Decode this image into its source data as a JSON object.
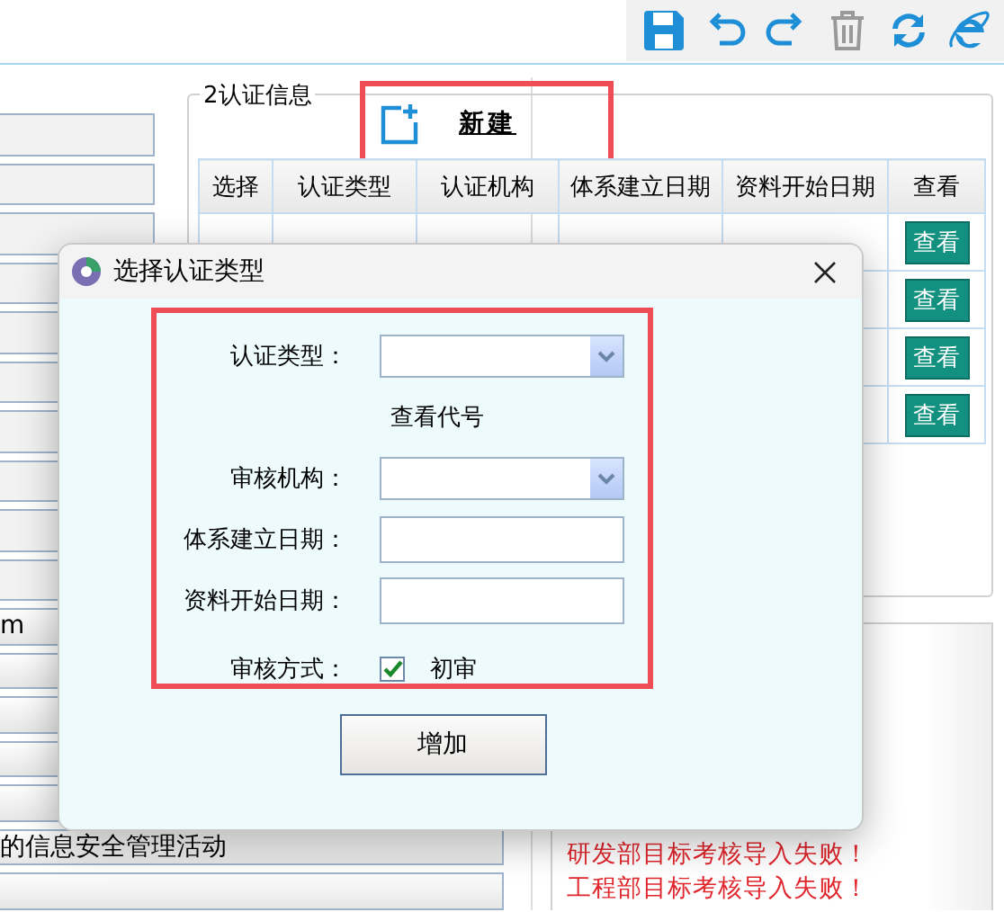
{
  "left_panel": {
    "rows": [
      "m",
      "的信息安全管理活动"
    ]
  },
  "cert_info": {
    "title": "2认证信息",
    "new_button": "新建",
    "table": {
      "columns": [
        "选择",
        "认证类型",
        "认证机构",
        "体系建立日期",
        "资料开始日期",
        "查看"
      ],
      "rows": [
        {
          "view": "查看"
        },
        {
          "view": "查看"
        },
        {
          "view": "查看"
        },
        {
          "view": "查看"
        }
      ]
    }
  },
  "messages": [
    "研发部目标考核导入失败！",
    "工程部目标考核导入失败！"
  ],
  "dialog": {
    "title": "选择认证类型",
    "fields": [
      {
        "kind": "combo",
        "label": "认证类型："
      },
      {
        "kind": "link",
        "text": "查看代号"
      },
      {
        "kind": "combo",
        "label": "审核机构："
      },
      {
        "kind": "text",
        "label": "体系建立日期："
      },
      {
        "kind": "text",
        "label": "资料开始日期："
      },
      {
        "kind": "checkbox",
        "label": "审核方式：",
        "checked": true,
        "text": "初审"
      }
    ],
    "button": "增加"
  }
}
